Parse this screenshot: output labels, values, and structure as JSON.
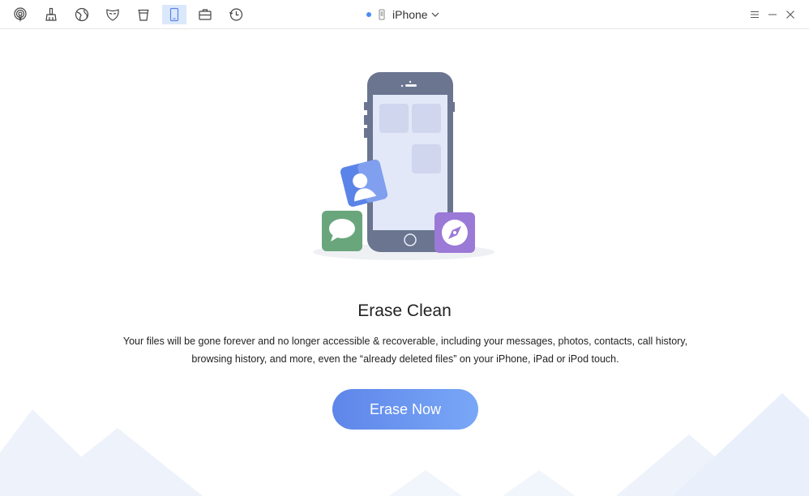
{
  "toolbar": {
    "icons": [
      {
        "name": "airdrop-icon",
        "active": false
      },
      {
        "name": "broom-icon",
        "active": false
      },
      {
        "name": "globe-icon",
        "active": false
      },
      {
        "name": "mask-icon",
        "active": false
      },
      {
        "name": "trash-bin-icon",
        "active": false
      },
      {
        "name": "phone-icon",
        "active": true
      },
      {
        "name": "toolbox-icon",
        "active": false
      },
      {
        "name": "history-icon",
        "active": false
      }
    ],
    "device_name": "iPhone",
    "device_status_color": "#4a8cf6"
  },
  "main": {
    "title": "Erase Clean",
    "description_line1": "Your files will be gone forever and no longer accessible & recoverable, including your messages, photos, contacts, call history,",
    "description_line2": "browsing history, and more, even the “already deleted files” on your iPhone, iPad or iPod touch.",
    "button_label": "Erase Now"
  },
  "colors": {
    "accent": "#5e86ea",
    "phone_body": "#6b7590",
    "phone_screen": "#e3e8f8",
    "messages_app": "#6aa67c",
    "contacts_app": "#5b84e8",
    "safari_app": "#9b79d6"
  }
}
